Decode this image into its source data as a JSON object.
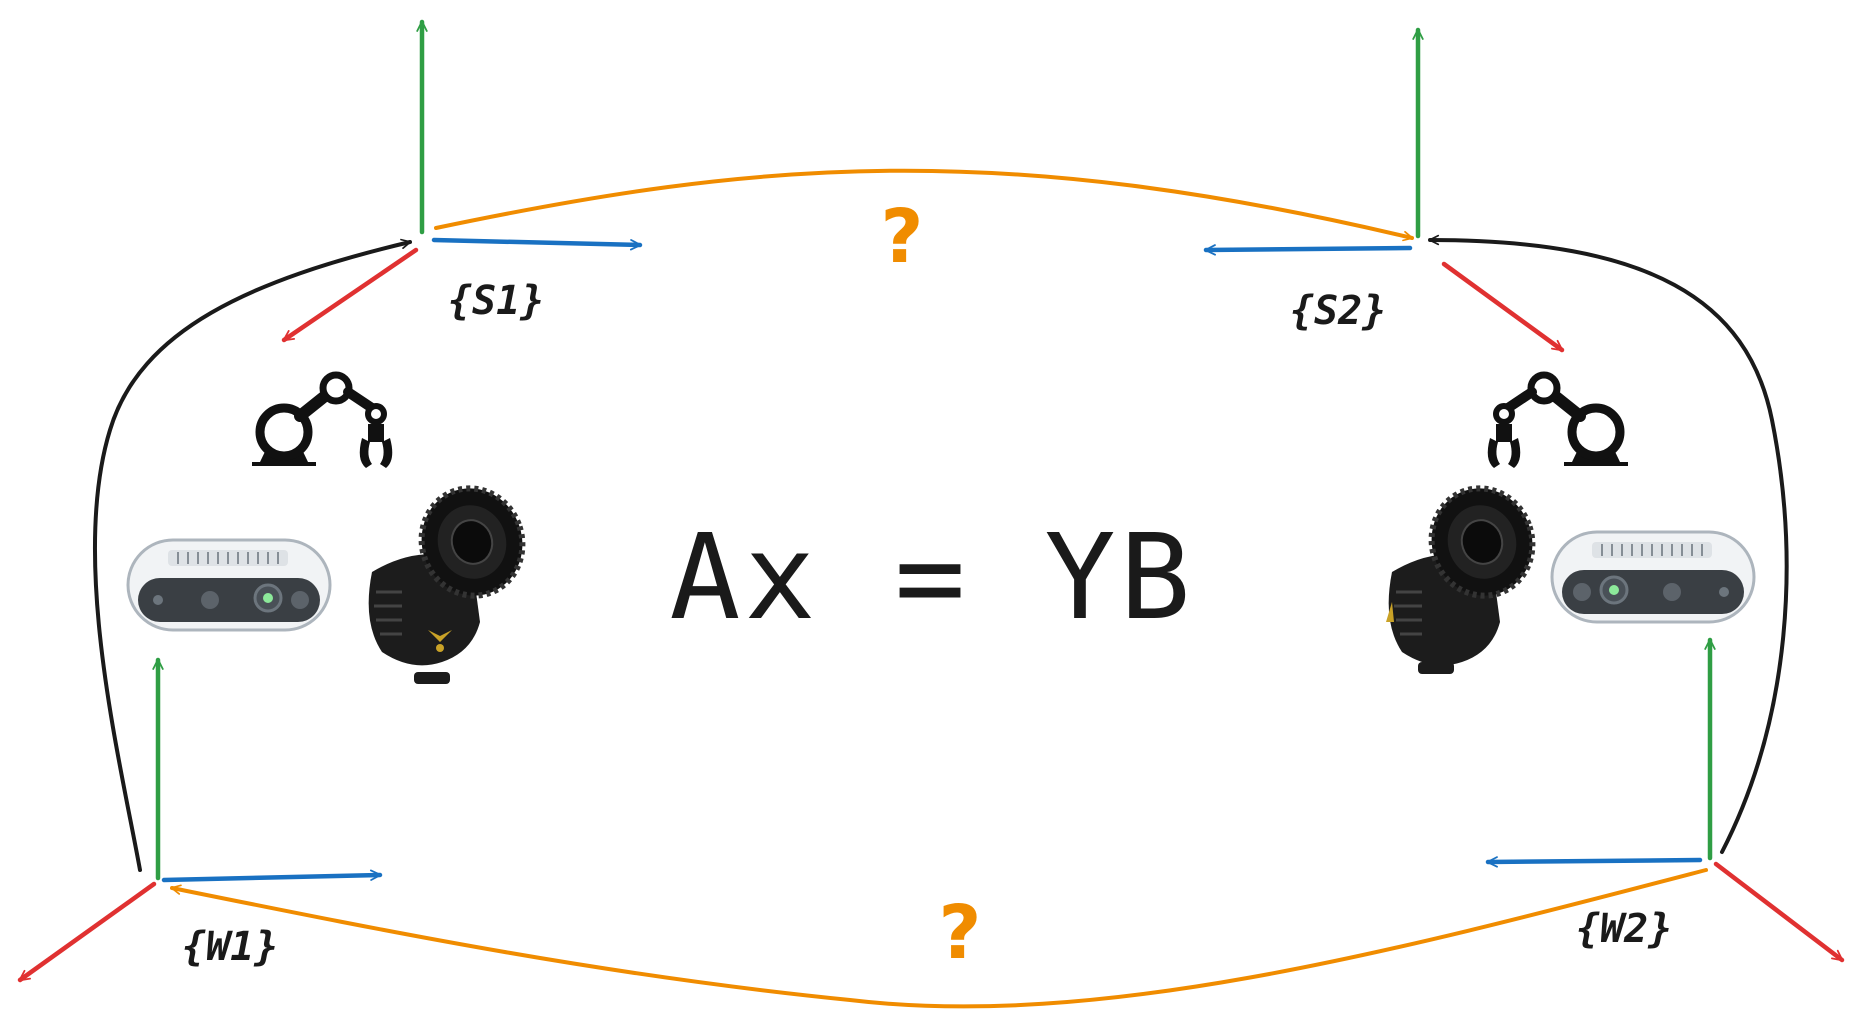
{
  "equation": "Ax = YB",
  "frames": {
    "s1": "{S1}",
    "s2": "{S2}",
    "w1": "{W1}",
    "w2": "{W2}"
  },
  "unknowns": {
    "top": "?",
    "bottom": "?"
  },
  "colors": {
    "x_axis": "#e03131",
    "y_axis": "#2f9e44",
    "z_axis": "#1971c2",
    "unknown_link": "#f08c00",
    "known_link": "#1a1a1a",
    "ink": "#1a1a1a"
  },
  "icons": {
    "robot_arm": "robot-arm-icon",
    "depth_camera": "depth-camera-icon",
    "tracking_camera": "tracking-camera-icon"
  }
}
